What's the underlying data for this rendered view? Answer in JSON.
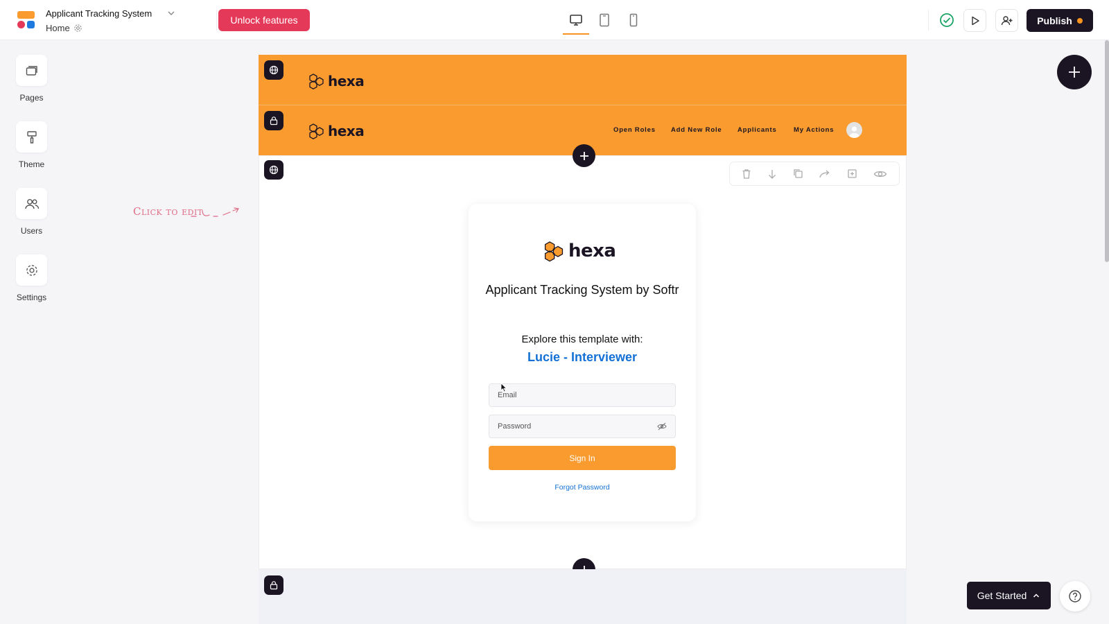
{
  "app": {
    "title": "Applicant Tracking System",
    "page": "Home",
    "colors": {
      "accent": "#f99b2f",
      "dark": "#1a1423",
      "unlock": "#e5395a",
      "link": "#1370d4"
    }
  },
  "toolbar": {
    "unlock_label": "Unlock features",
    "publish_label": "Publish",
    "devices": [
      "desktop-icon",
      "tablet-icon",
      "mobile-icon"
    ],
    "selected_device": "desktop"
  },
  "sidebar": {
    "items": [
      {
        "label": "Pages",
        "icon": "pages-icon"
      },
      {
        "label": "Theme",
        "icon": "paint-roller-icon"
      },
      {
        "label": "Users",
        "icon": "users-icon"
      },
      {
        "label": "Settings",
        "icon": "gear-icon"
      }
    ]
  },
  "hint": {
    "click_to_edit": "Click to edit"
  },
  "header": {
    "brand": "hexa",
    "nav": [
      "Open Roles",
      "Add New Role",
      "Applicants",
      "My Actions"
    ]
  },
  "login": {
    "brand": "hexa",
    "title": "Applicant Tracking System by Softr",
    "explore": "Explore this template with:",
    "user": "Lucie - Interviewer",
    "email_placeholder": "Email",
    "password_placeholder": "Password",
    "signin": "Sign In",
    "forgot": "Forgot Password"
  },
  "footer": {
    "get_started": "Get Started"
  }
}
